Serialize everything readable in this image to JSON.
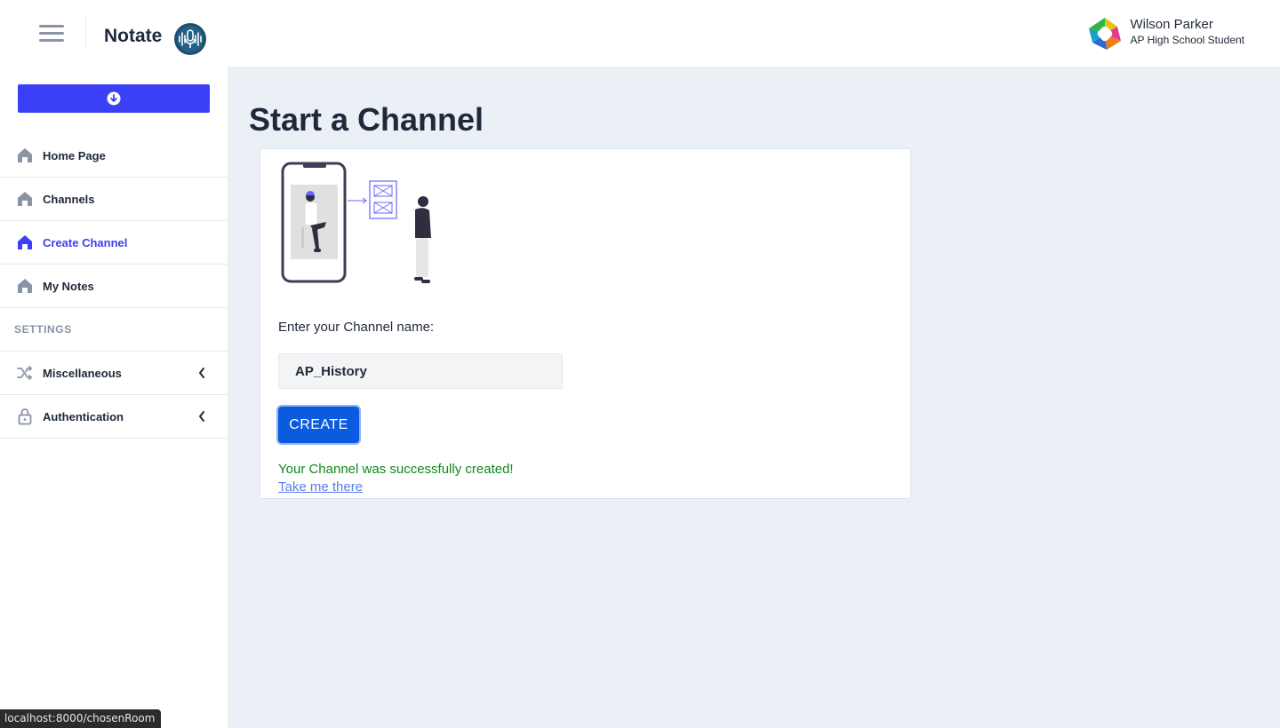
{
  "header": {
    "brand": "Notate",
    "user_name": "Wilson Parker",
    "user_role": "AP High School Student"
  },
  "sidebar": {
    "items": [
      {
        "label": "Home Page",
        "icon": "home-icon"
      },
      {
        "label": "Channels",
        "icon": "home-icon"
      },
      {
        "label": "Create Channel",
        "icon": "home-icon",
        "active": true
      },
      {
        "label": "My Notes",
        "icon": "home-icon"
      }
    ],
    "section_label": "SETTINGS",
    "settings_items": [
      {
        "label": "Miscellaneous",
        "icon": "shuffle-icon"
      },
      {
        "label": "Authentication",
        "icon": "lock-icon"
      }
    ]
  },
  "main": {
    "title": "Start a Channel",
    "field_label": "Enter your Channel name:",
    "channel_name_value": "AP_History",
    "create_label": "CREATE",
    "success_message": "Your Channel was successfully created!",
    "link_label": "Take me there"
  },
  "status_bar": {
    "url": "localhost:8000/chosenRoom"
  },
  "colors": {
    "accent": "#3b3ff7",
    "primary_button": "#0a5be0",
    "success": "#0f8a1a",
    "link": "#5b7de8",
    "background": "#ebf0f7"
  }
}
